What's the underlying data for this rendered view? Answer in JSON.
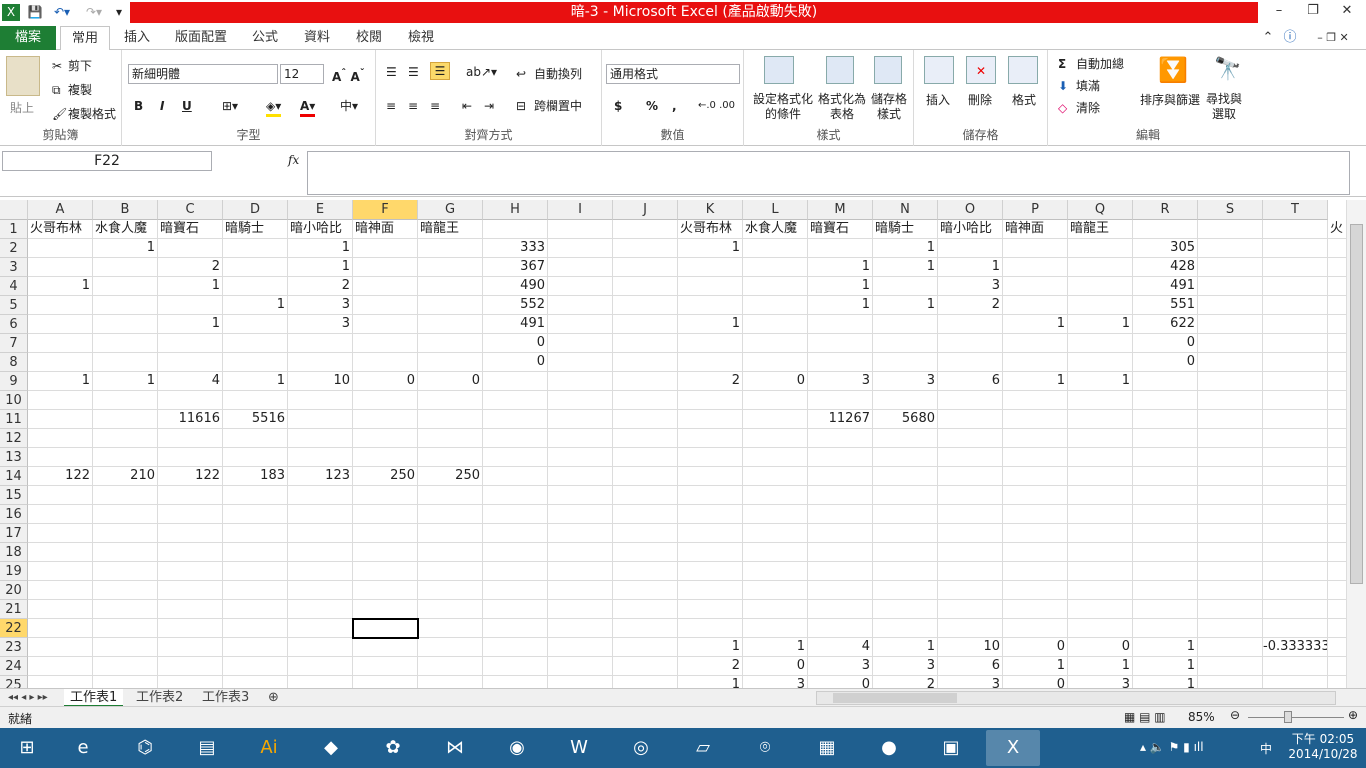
{
  "window": {
    "title": "暗-3 - Microsoft Excel (產品啟動失敗)",
    "controls": [
      "–",
      "❐",
      "✕"
    ]
  },
  "tabs": {
    "file": "檔案",
    "items": [
      "常用",
      "插入",
      "版面配置",
      "公式",
      "資料",
      "校閱",
      "檢視"
    ],
    "active": "常用"
  },
  "ribbon": {
    "clipboard": {
      "label": "剪貼簿",
      "paste": "貼上",
      "cut": "剪下",
      "copy": "複製",
      "format_painter": "複製格式"
    },
    "font": {
      "label": "字型",
      "name": "新細明體",
      "size": "12",
      "bold": "B",
      "italic": "I",
      "underline": "U"
    },
    "alignment": {
      "label": "對齊方式",
      "wrap": "自動換列",
      "merge": "跨欄置中"
    },
    "number": {
      "label": "數值",
      "format": "通用格式",
      "currency": "$",
      "percent": "%",
      "comma": ","
    },
    "styles": {
      "label": "樣式",
      "conditional": "設定格式化的條件",
      "as_table": "格式化為表格",
      "cell_styles": "儲存格樣式"
    },
    "cells": {
      "label": "儲存格",
      "insert": "插入",
      "delete": "刪除",
      "format": "格式"
    },
    "editing": {
      "label": "編輯",
      "autosum": "自動加總",
      "fill": "填滿",
      "clear": "清除",
      "sort": "排序與篩選",
      "find": "尋找與選取"
    }
  },
  "formula_bar": {
    "name_box": "F22",
    "fx": "fx",
    "content": ""
  },
  "columns": [
    "A",
    "B",
    "C",
    "D",
    "E",
    "F",
    "G",
    "H",
    "I",
    "J",
    "K",
    "L",
    "M",
    "N",
    "O",
    "P",
    "Q",
    "R",
    "S",
    "T"
  ],
  "selected_column": "F",
  "selected_row": 22,
  "rows": [
    {
      "r": 1,
      "cells": {
        "A": "火哥布林",
        "B": "水食人魔",
        "C": "暗寶石",
        "D": "暗騎士",
        "E": "暗小哈比",
        "F": "暗神面",
        "G": "暗龍王",
        "K": "火哥布林",
        "L": "水食人魔",
        "M": "暗寶石",
        "N": "暗騎士",
        "O": "暗小哈比",
        "P": "暗神面",
        "Q": "暗龍王",
        "U": "火"
      }
    },
    {
      "r": 2,
      "cells": {
        "B": "1",
        "E": "1",
        "H": "333",
        "K": "1",
        "N": "1",
        "R": "305"
      }
    },
    {
      "r": 3,
      "cells": {
        "C": "2",
        "E": "1",
        "H": "367",
        "M": "1",
        "N": "1",
        "O": "1",
        "R": "428"
      }
    },
    {
      "r": 4,
      "cells": {
        "A": "1",
        "C": "1",
        "E": "2",
        "H": "490",
        "M": "1",
        "O": "3",
        "R": "491"
      }
    },
    {
      "r": 5,
      "cells": {
        "D": "1",
        "E": "3",
        "H": "552",
        "M": "1",
        "N": "1",
        "O": "2",
        "R": "551"
      }
    },
    {
      "r": 6,
      "cells": {
        "C": "1",
        "E": "3",
        "H": "491",
        "K": "1",
        "P": "1",
        "Q": "1",
        "R": "622"
      }
    },
    {
      "r": 7,
      "cells": {
        "H": "0",
        "R": "0"
      }
    },
    {
      "r": 8,
      "cells": {
        "H": "0",
        "R": "0"
      }
    },
    {
      "r": 9,
      "cells": {
        "A": "1",
        "B": "1",
        "C": "4",
        "D": "1",
        "E": "10",
        "F": "0",
        "G": "0",
        "K": "2",
        "L": "0",
        "M": "3",
        "N": "3",
        "O": "6",
        "P": "1",
        "Q": "1"
      }
    },
    {
      "r": 10,
      "cells": {}
    },
    {
      "r": 11,
      "cells": {
        "C": "11616",
        "D": "5516",
        "M": "11267",
        "N": "5680"
      }
    },
    {
      "r": 12,
      "cells": {}
    },
    {
      "r": 13,
      "cells": {}
    },
    {
      "r": 14,
      "cells": {
        "A": "122",
        "B": "210",
        "C": "122",
        "D": "183",
        "E": "123",
        "F": "250",
        "G": "250"
      }
    },
    {
      "r": 15,
      "cells": {}
    },
    {
      "r": 16,
      "cells": {}
    },
    {
      "r": 17,
      "cells": {}
    },
    {
      "r": 18,
      "cells": {}
    },
    {
      "r": 19,
      "cells": {}
    },
    {
      "r": 20,
      "cells": {}
    },
    {
      "r": 21,
      "cells": {}
    },
    {
      "r": 22,
      "cells": {}
    },
    {
      "r": 23,
      "cells": {
        "K": "1",
        "L": "1",
        "M": "4",
        "N": "1",
        "O": "10",
        "P": "0",
        "Q": "0",
        "R": "1",
        "T": "-0.333333"
      }
    },
    {
      "r": 24,
      "cells": {
        "K": "2",
        "L": "0",
        "M": "3",
        "N": "3",
        "O": "6",
        "P": "1",
        "Q": "1",
        "R": "1"
      }
    },
    {
      "r": 25,
      "cells": {
        "K": "1",
        "L": "3",
        "M": "0",
        "N": "2",
        "O": "3",
        "P": "0",
        "Q": "3",
        "R": "1"
      }
    }
  ],
  "sheets": [
    "工作表1",
    "工作表2",
    "工作表3"
  ],
  "active_sheet": "工作表1",
  "status": {
    "ready": "就緒",
    "zoom": "85%"
  },
  "clock": {
    "time": "下午 02:05",
    "date": "2014/10/28",
    "ime": "中"
  },
  "colors": {
    "file_tab": "#1e7e34",
    "title_bar": "#e81010",
    "selected_header": "#ffd86b",
    "taskbar": "#1f5f8f"
  }
}
